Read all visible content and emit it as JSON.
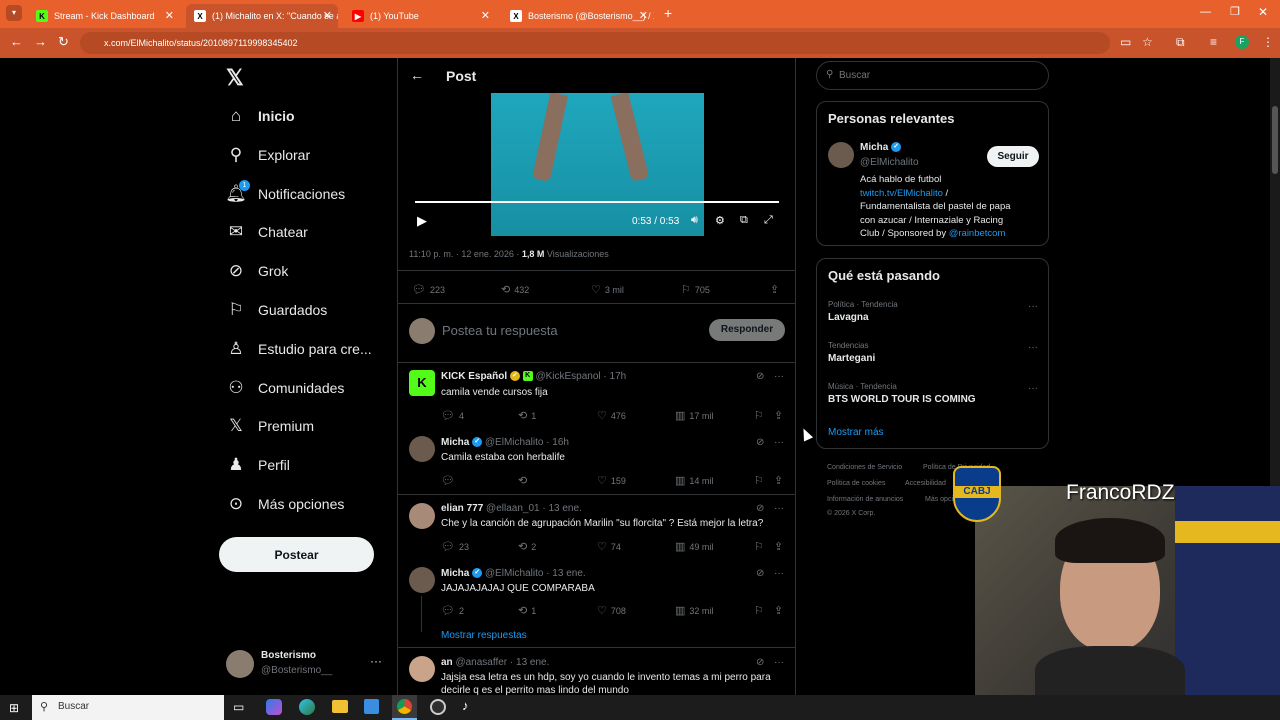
{
  "browser": {
    "tabs": [
      {
        "title": "Stream - Kick Dashboard",
        "fav": "K",
        "fav_color": "#53fc18"
      },
      {
        "title": "(1) Michalito en X: \"Cuando se a...",
        "fav": "X",
        "fav_color": "#000000"
      },
      {
        "title": "(1) YouTube",
        "fav": "▶",
        "fav_color": "#ff0000"
      },
      {
        "title": "Bosterismo (@Bosterismo__) / X",
        "fav": "X",
        "fav_color": "#000000"
      }
    ],
    "url": "x.com/ElMichalito/status/2010897119998345402",
    "profile_initial": "F"
  },
  "nav": {
    "items": [
      "Inicio",
      "Explorar",
      "Notificaciones",
      "Chatear",
      "Grok",
      "Guardados",
      "Estudio para cre...",
      "Comunidades",
      "Premium",
      "Perfil",
      "Más opciones"
    ],
    "notif_badge": "1",
    "post_button": "Postear",
    "account_name": "Bosterismo",
    "account_handle": "@Bosterismo__"
  },
  "post": {
    "header": "Post",
    "video_time": "0:53 / 0:53",
    "meta_time": "11:10 p. m. · 12 ene. 2026 · ",
    "views": "1,8 M",
    "views_label": " Visualizaciones",
    "replies": "223",
    "reposts": "432",
    "likes": "3 mil",
    "bookmarks": "705",
    "reply_placeholder": "Postea tu respuesta",
    "reply_button": "Responder",
    "progress": 1.0
  },
  "replies": [
    {
      "name": "KICK Español",
      "handle": "@KickEspanol · 17h",
      "text": "camila vende cursos fija",
      "r": "4",
      "rt": "1",
      "l": "476",
      "v": "17 mil"
    },
    {
      "name": "Micha",
      "handle": "@ElMichalito · 16h",
      "text": "Camila estaba con herbalife",
      "r": "",
      "rt": "",
      "l": "159",
      "v": "14 mil"
    },
    {
      "name": "elian 777",
      "handle": "@ellaan_01 · 13 ene.",
      "text": "Che y la canción de agrupación Marilin \"su florcita\" ? Está mejor la letra?",
      "r": "23",
      "rt": "2",
      "l": "74",
      "v": "49 mil"
    },
    {
      "name": "Micha",
      "handle": "@ElMichalito · 13 ene.",
      "text": "JAJAJAJAJAJ QUE COMPARABA",
      "r": "2",
      "rt": "1",
      "l": "708",
      "v": "32 mil"
    },
    {
      "name": "an",
      "handle": "@anasaffer · 13 ene.",
      "text": "Jajsja esa letra es un hdp, soy yo cuando le invento temas a mi perro para",
      "text2": "decirle q es el perrito mas lindo del mundo",
      "r": "",
      "rt": "",
      "l": "",
      "v": ""
    }
  ],
  "show_replies": "Mostrar respuestas",
  "right": {
    "search_placeholder": "Buscar",
    "relevant_title": "Personas relevantes",
    "person_name": "Micha",
    "person_handle": "@ElMichalito",
    "follow": "Seguir",
    "bio_1": "Acá hablo de futbol",
    "bio_link": "twitch.tv/ElMichalito",
    "bio_2": " /",
    "bio_3": "Fundamentalista del pastel de papa",
    "bio_4": "con azucar / Internaziale y Racing",
    "bio_5": "Club / Sponsored by ",
    "bio_link2": "@rainbetcom",
    "trending_title": "Qué está pasando",
    "trends": [
      {
        "cat": "Política · Tendencia",
        "name": "Lavagna"
      },
      {
        "cat": "Tendencias",
        "name": "Martegani"
      },
      {
        "cat": "Música · Tendencia",
        "name": "BTS WORLD TOUR IS COMING"
      }
    ],
    "show_more": "Mostrar más",
    "footer": [
      "Condiciones de Servicio",
      "Política de Privacidad",
      "Política de cookies",
      "Accesibilidad",
      "Información de anuncios",
      "Más opciones ...",
      "© 2026 X Corp."
    ]
  },
  "overlay": {
    "streamer": "FrancoRDZ",
    "badge": "CABJ"
  },
  "taskbar": {
    "search": "Buscar"
  }
}
